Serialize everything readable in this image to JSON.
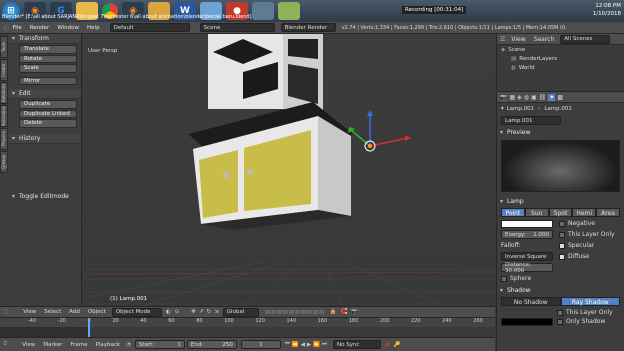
{
  "taskbar": {
    "icons": [
      "windows-start",
      "blender",
      "chrome-g",
      "explorer",
      "chrome",
      "blender-2",
      "folder",
      "word",
      "paint",
      "camera",
      "screenshot",
      "image"
    ],
    "time": "12:08 PM",
    "date": "1/10/2018",
    "recording": "Recording [00:31:04]"
  },
  "blender": {
    "window_title": "Blender* [E:\\all about SARJANA\\tingkat 7\\semester 6\\all about animation\\blender\\becak baru.blend]",
    "menus": [
      "File",
      "Render",
      "Window",
      "Help"
    ],
    "layout": "Default",
    "scene": "Scene",
    "engine": "Blender Render",
    "stats": "v2.74 | Verts:1,334 | Faces:1,299 | Tris:2,610 | Objects:1/11 | Lamps:1/5 | Mem:14.05M (0.58M) | Lamp.001"
  },
  "toolshelf": {
    "transform_title": "Transform",
    "transform_buttons": [
      "Translate",
      "Rotate",
      "Scale"
    ],
    "mirror": "Mirror",
    "edit_title": "Edit",
    "edit_buttons": [
      "Duplicate",
      "Duplicate Linked",
      "Delete"
    ],
    "history_title": "History",
    "toggle": "Toggle Editmode",
    "tabs": [
      "Tools",
      "Create",
      "Relations",
      "Animation",
      "Physics",
      "Grease Pencil"
    ]
  },
  "viewport": {
    "view_label": "User Persp",
    "object_label": "(1) Lamp.001"
  },
  "outliner": {
    "menus": [
      "View",
      "Search"
    ],
    "filter": "All Scenes",
    "items": [
      "Scene",
      "RenderLayers",
      "World"
    ]
  },
  "props": {
    "breadcrumb": "Lamp.001",
    "breadcrumb2": "Lamp.001",
    "datablock": "Lamp.001",
    "preview_title": "Preview",
    "lamp_title": "Lamp",
    "lamp_types": [
      "Point",
      "Sun",
      "Spot",
      "Hemi",
      "Area"
    ],
    "negative": "Negative",
    "energy_label": "Energy:",
    "energy_value": "1.000",
    "this_layer_only": "This Layer Only",
    "falloff_label": "Falloff:",
    "specular": "Specular",
    "falloff_value": "Inverse Square",
    "diffuse": "Diffuse",
    "distance": "Distance: 30.000",
    "sphere": "Sphere",
    "shadow_title": "Shadow",
    "no_shadow": "No Shadow",
    "ray_shadow": "Ray Shadow",
    "this_layer_only2": "This Layer Only",
    "only_shadow": "Only Shadow"
  },
  "vp_header": {
    "menus": [
      "View",
      "Select",
      "Add",
      "Object"
    ],
    "mode": "Object Mode",
    "pivot": "Global"
  },
  "timeline": {
    "ticks": [
      "-40",
      "-20",
      "0",
      "20",
      "40",
      "60",
      "80",
      "100",
      "120",
      "140",
      "160",
      "180",
      "200",
      "220",
      "240",
      "260"
    ],
    "menus": [
      "View",
      "Marker",
      "Frame",
      "Playback"
    ],
    "start_label": "Start:",
    "start": "1",
    "end_label": "End:",
    "end": "250",
    "current": "1",
    "sync": "No Sync"
  },
  "colors": {
    "accent": "#5680c2",
    "cabinet_door": "#c9bd4a",
    "cabinet_white": "#e8e8e8"
  }
}
